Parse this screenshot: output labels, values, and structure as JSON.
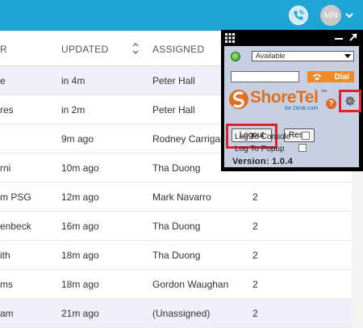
{
  "topbar": {
    "background": "#1ea5d6",
    "phone_icon": "phone-icon",
    "avatar_initials": "MN",
    "avatar_menu_icon": "chevron-down-icon"
  },
  "table": {
    "columns": [
      {
        "label": "R"
      },
      {
        "label": "UPDATED"
      },
      {
        "label": "ASSIGNED"
      }
    ],
    "sort_icon": "sort-arrows-icon",
    "rows": [
      {
        "subject": "e",
        "updated": "in 4m",
        "assigned": "Peter Hall",
        "count": "",
        "highlight": true
      },
      {
        "subject": "res",
        "updated": "in 2m",
        "assigned": "Peter Hall",
        "count": "",
        "highlight": false
      },
      {
        "subject": "",
        "updated": "9m ago",
        "assigned": "Rodney Carrigan",
        "count": "",
        "highlight": false
      },
      {
        "subject": "rni",
        "updated": "10m ago",
        "assigned": "Tha Duong",
        "count": "",
        "highlight": false
      },
      {
        "subject": "m PSG",
        "updated": "12m ago",
        "assigned": "Mark Navarro",
        "count": "2",
        "highlight": false
      },
      {
        "subject": "enbeck",
        "updated": "16m ago",
        "assigned": "Tha Duong",
        "count": "2",
        "highlight": false
      },
      {
        "subject": "ith",
        "updated": "18m ago",
        "assigned": "Tha Duong",
        "count": "2",
        "highlight": false
      },
      {
        "subject": "ms",
        "updated": "18m ago",
        "assigned": "Gordon Waughan",
        "count": "2",
        "highlight": false
      },
      {
        "subject": "am",
        "updated": "21m ago",
        "assigned": "(Unassigned)",
        "count": "2",
        "highlight": true
      }
    ]
  },
  "shoretel": {
    "status_value": "Available",
    "dial_label": "Dial",
    "logo_text": "ShoreTel",
    "logo_tm": "™",
    "logo_subtitle": "for Desk.com",
    "help_label": "?",
    "logout_label": "Logout",
    "reset_label": "Reset",
    "log_console_label": "Log To Console",
    "log_popup_label": "Log To Popup",
    "version_text": "Version: 1.0.4",
    "highlight_color": "#e0202a",
    "accent_color": "#f08a24"
  }
}
